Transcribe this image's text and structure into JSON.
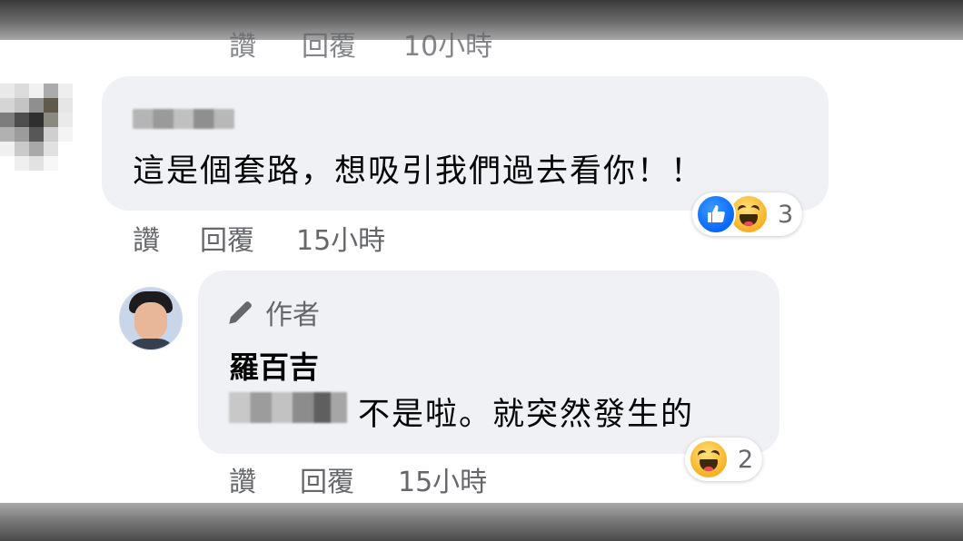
{
  "prev_actions": {
    "like": "讚",
    "reply": "回覆",
    "time": "10小時"
  },
  "comment1": {
    "text": "這是個套路，想吸引我們過去看你！！",
    "reaction_icons": [
      "like-icon",
      "haha-icon"
    ],
    "reaction_count": "3",
    "actions": {
      "like": "讚",
      "reply": "回覆",
      "time": "15小時"
    }
  },
  "reply1": {
    "author_badge": "作者",
    "author_badge_icon": "pencil-icon",
    "commenter": "羅百吉",
    "text": "不是啦。就突然發生的",
    "reaction_icons": [
      "haha-icon"
    ],
    "reaction_count": "2",
    "actions": {
      "like": "讚",
      "reply": "回覆",
      "time": "15小時"
    }
  },
  "colors": {
    "bubble": "#eff1f5",
    "meta_text": "#65676b",
    "text": "#050505",
    "like_blue": "#0866ff",
    "haha_yellow": "#f7b125"
  }
}
